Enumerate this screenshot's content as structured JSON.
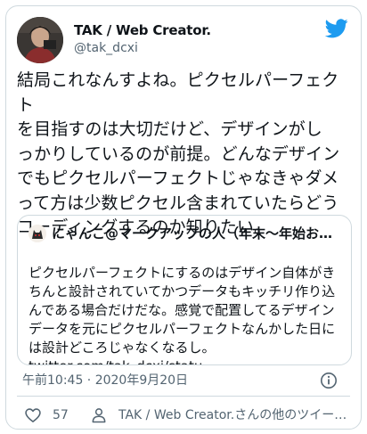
{
  "tweet": {
    "display_name": "TAK / Web Creator.",
    "handle": "@tak_dcxi",
    "text": "結局これなんすよね。ピクセルパーフェクト\nを目指すのは大切だけど、デザインがし\nっかりしているのが前提。どんなデザイン\nでもピクセルパーフェクトじゃなきゃダメ\nって方は少数ピクセル含まれていたらどう\nコーディングするのか知りたい。",
    "timestamp": "午前10:45 · 2020年9月20日"
  },
  "quote": {
    "author": "にゃんこ@マークアップの人（年末〜年始お…",
    "text": "ピクセルパーフェクトにするのはデザイン自体がき\nちんと設計されていてかつデータもキッチリ作り込\nんである場合だけだな。感覚で配置してるデザイン\nデータを元にピクセルパーフェクトなんかした日に\nは設計どころじゃなくなるし。",
    "link": "twitter.com/tak_dcxi/statu…"
  },
  "actions": {
    "like_count": "57",
    "others_text": "TAK / Web Creator.さんの他のツイー…"
  },
  "icons": {
    "brand": "twitter-bird-icon",
    "info": "info-icon",
    "like": "heart-icon",
    "person": "person-icon"
  },
  "colors": {
    "brand_blue": "#1d9bf0",
    "text": "#0f1419",
    "secondary": "#536471",
    "border": "#cfd9de"
  }
}
